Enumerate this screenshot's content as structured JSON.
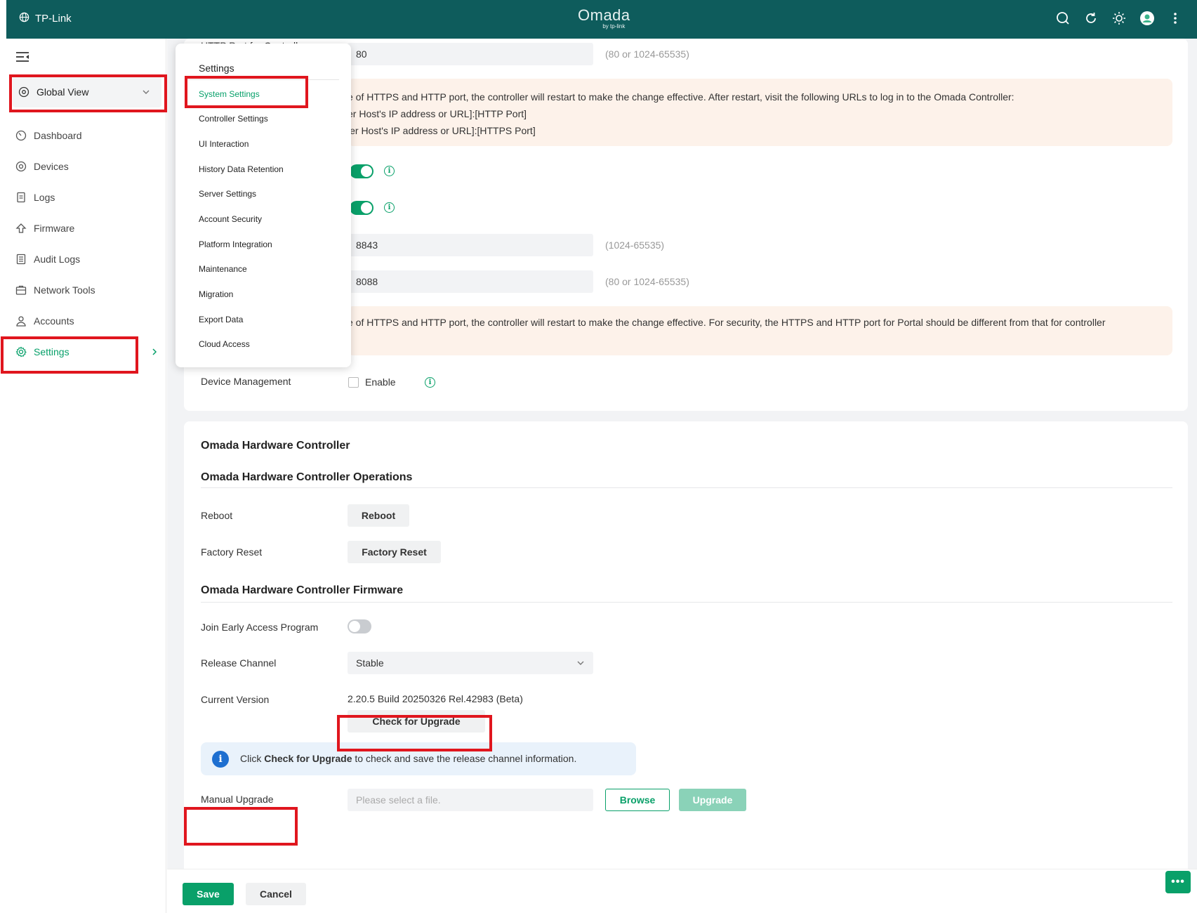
{
  "topbar": {
    "brand": "TP-Link",
    "logo": "Omada",
    "logo_sub": "by tp-link",
    "icons": [
      "search-icon",
      "refresh-icon",
      "theme-icon",
      "avatar",
      "more-icon"
    ]
  },
  "sidebar": {
    "global_view": "Global View",
    "items": [
      {
        "label": "Dashboard",
        "icon": "dashboard-icon"
      },
      {
        "label": "Devices",
        "icon": "devices-icon"
      },
      {
        "label": "Logs",
        "icon": "logs-icon"
      },
      {
        "label": "Firmware",
        "icon": "firmware-icon"
      },
      {
        "label": "Audit Logs",
        "icon": "audit-logs-icon"
      },
      {
        "label": "Network Tools",
        "icon": "network-tools-icon"
      },
      {
        "label": "Accounts",
        "icon": "accounts-icon"
      },
      {
        "label": "Settings",
        "icon": "settings-icon"
      }
    ]
  },
  "menu": {
    "title": "Settings",
    "items": [
      "System Settings",
      "Controller Settings",
      "UI Interaction",
      "History Data Retention",
      "Server Settings",
      "Account Security",
      "Platform Integration",
      "Maintenance",
      "Migration",
      "Export Data",
      "Cloud Access"
    ]
  },
  "access_config": {
    "http_port_label": "HTTP Port for Controll",
    "http_port_value": "80",
    "http_port_hint": "(80 or 1024-65535)",
    "notice1": [
      "e of HTTPS and HTTP port, the controller will restart to make the change effective. After restart, visit the following URLs to log in to the Omada Controller:",
      "er Host's IP address or URL]:[HTTP Port]",
      "ler Host's IP address or URL]:[HTTPS Port]"
    ],
    "portal_https_value": "8843",
    "portal_https_hint": "(1024-65535)",
    "portal_http_value": "8088",
    "portal_http_hint": "(80 or 1024-65535)",
    "notice2": "e of HTTPS and HTTP port, the controller will restart to make the change effective. For security, the HTTPS and HTTP port for Portal should be different from that for controller",
    "device_management_label": "Device Management",
    "device_management_enable": "Enable"
  },
  "hardware": {
    "title": "Omada Hardware Controller",
    "operations_title": "Omada Hardware Controller Operations",
    "reboot_label": "Reboot",
    "reboot_button": "Reboot",
    "factory_label": "Factory Reset",
    "factory_button": "Factory Reset",
    "firmware_title": "Omada Hardware Controller Firmware",
    "early_access_label": "Join Early Access Program",
    "release_channel_label": "Release Channel",
    "release_channel_value": "Stable",
    "current_version_label": "Current Version",
    "current_version_value": "2.20.5 Build 20250326 Rel.42983 (Beta)",
    "check_upgrade_button": "Check for Upgrade",
    "info_prefix": "Click ",
    "info_bold": "Check for Upgrade",
    "info_suffix": " to check and save the release channel information.",
    "manual_upgrade_label": "Manual Upgrade",
    "file_placeholder": "Please select a file.",
    "browse_button": "Browse",
    "upgrade_button": "Upgrade"
  },
  "footer": {
    "save": "Save",
    "cancel": "Cancel"
  },
  "colors": {
    "topbar": "#0e5c5c",
    "accent": "#09a069",
    "annotation": "#e0161e"
  }
}
